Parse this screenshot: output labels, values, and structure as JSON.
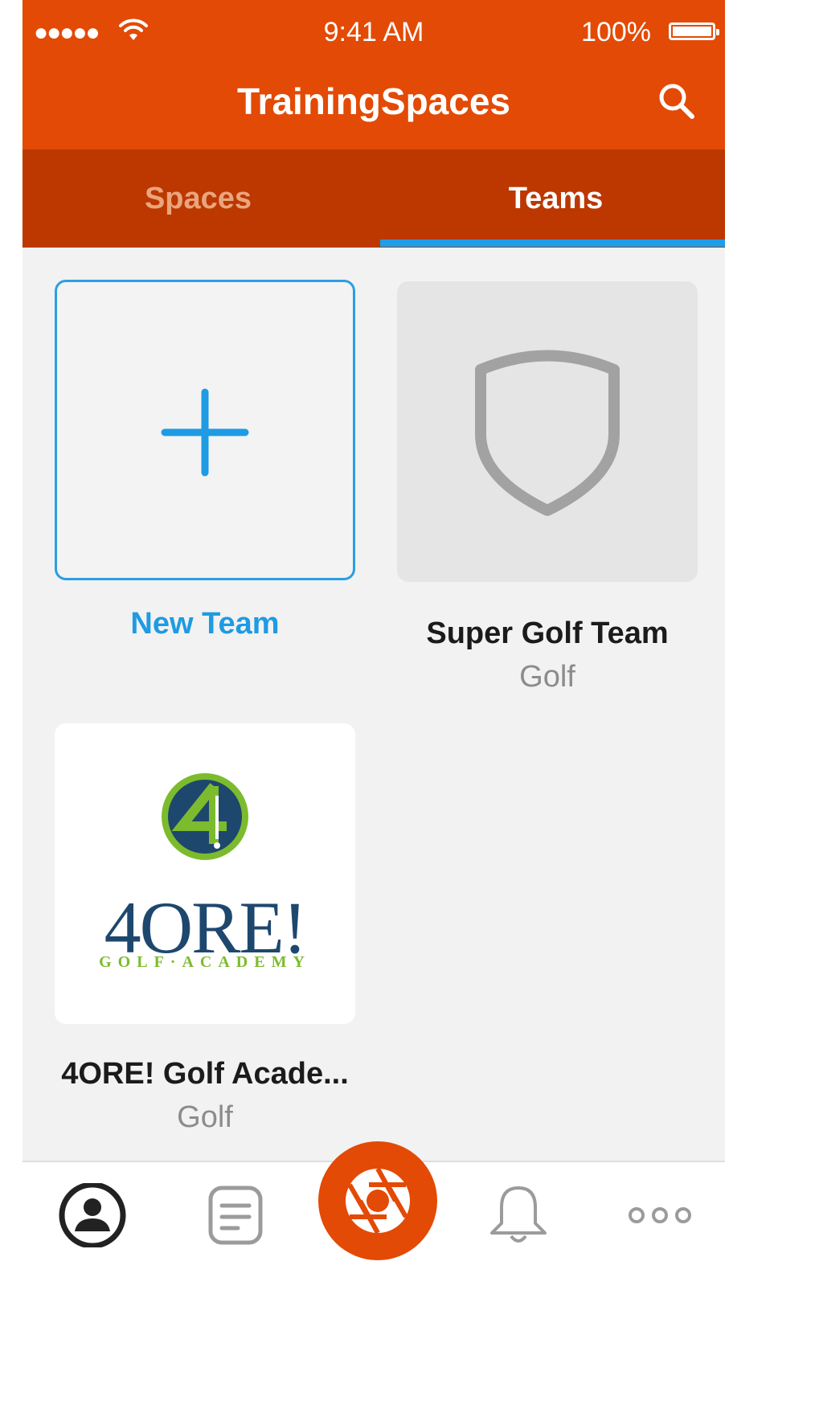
{
  "status_bar": {
    "signal": "●●●●●",
    "time": "9:41 AM",
    "battery": "100%"
  },
  "nav": {
    "title": "TrainingSpaces"
  },
  "tabs": [
    {
      "label": "Spaces",
      "selected": false
    },
    {
      "label": "Teams",
      "selected": true
    }
  ],
  "teams": {
    "new_team_label": "New Team",
    "items": [
      {
        "name": "Super Golf Team",
        "sport": "Golf",
        "image": "shield-placeholder-icon"
      },
      {
        "name": "4ORE! Golf Acade...",
        "sport": "Golf",
        "image": "4ore-golf-academy-logo",
        "logo_text": "4ORE!",
        "logo_tagline": "GOLF·ACADEMY"
      }
    ]
  },
  "tab_bar": {
    "items": [
      "profile-icon",
      "feed-icon",
      "camera-icon",
      "bell-icon",
      "more-icon"
    ]
  },
  "colors": {
    "brand": "#e34a05",
    "tab_bg": "#bc3800",
    "accent": "#1f9de6"
  }
}
